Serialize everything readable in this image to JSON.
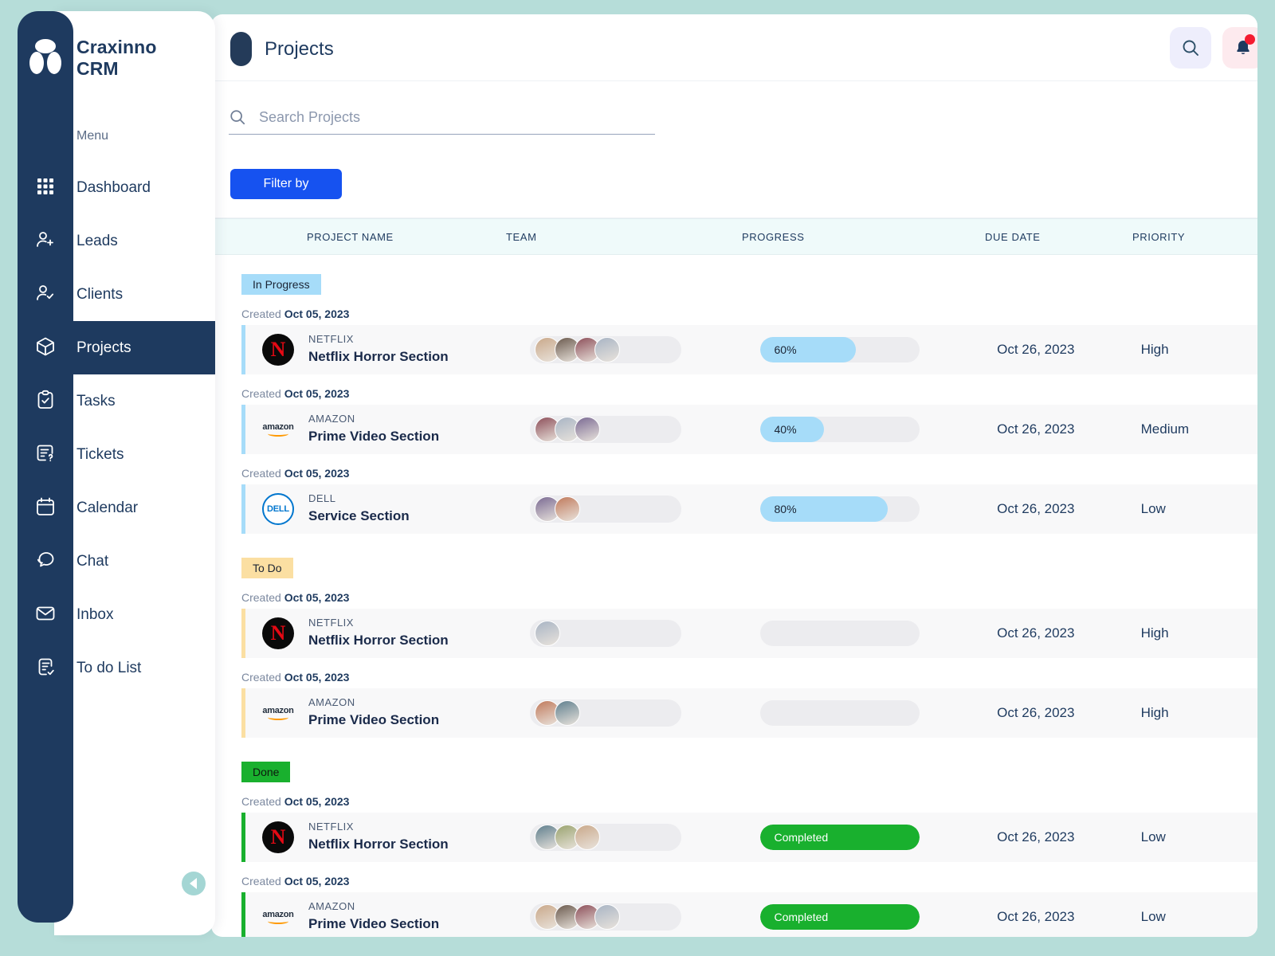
{
  "brand": {
    "name": "Craxinno CRM"
  },
  "sidebar": {
    "menu_label": "Menu",
    "items": [
      {
        "label": "Dashboard",
        "icon": "grid-icon",
        "active": false
      },
      {
        "label": "Leads",
        "icon": "user-plus-icon",
        "active": false
      },
      {
        "label": "Clients",
        "icon": "user-check-icon",
        "active": false
      },
      {
        "label": "Projects",
        "icon": "box-icon",
        "active": true
      },
      {
        "label": "Tasks",
        "icon": "clipboard-check-icon",
        "active": false
      },
      {
        "label": "Tickets",
        "icon": "ticket-question-icon",
        "active": false
      },
      {
        "label": "Calendar",
        "icon": "calendar-icon",
        "active": false
      },
      {
        "label": "Chat",
        "icon": "chat-bubbles-icon",
        "active": false
      },
      {
        "label": "Inbox",
        "icon": "envelope-icon",
        "active": false
      },
      {
        "label": "To do List",
        "icon": "list-check-icon",
        "active": false
      }
    ],
    "collapse_icon": "chevron-left-icon"
  },
  "header": {
    "title": "Projects",
    "search_icon": "search-icon",
    "bell_icon": "bell-icon",
    "has_notification": true
  },
  "toolbar": {
    "search_icon": "search-icon",
    "search_value": "",
    "search_placeholder": "Search Projects",
    "filter_label": "Filter by",
    "filter_color": "#1652F0"
  },
  "table": {
    "columns": [
      "PROJECT NAME",
      "TEAM",
      "PROGRESS",
      "DUE DATE",
      "PRIORITY"
    ],
    "groups": [
      {
        "status": "In Progress",
        "badge_bg": "#A6DCF9",
        "accent": "#A6DCF9",
        "rows": [
          {
            "created_label": "Created",
            "created_date": "Oct 05, 2023",
            "logo": "netflix",
            "company": "NETFLIX",
            "project": "Netflix Horror Section",
            "team_count": 4,
            "progress_type": "percent",
            "progress": "60%",
            "progress_value": 60,
            "due": "Oct 26, 2023",
            "priority": "High"
          },
          {
            "created_label": "Created",
            "created_date": "Oct 05, 2023",
            "logo": "amazon",
            "company": "AMAZON",
            "project": "Prime Video Section",
            "team_count": 3,
            "progress_type": "percent",
            "progress": "40%",
            "progress_value": 40,
            "due": "Oct 26, 2023",
            "priority": "Medium"
          },
          {
            "created_label": "Created",
            "created_date": "Oct 05, 2023",
            "logo": "dell",
            "company": "DELL",
            "project": "Service Section",
            "team_count": 2,
            "progress_type": "percent",
            "progress": "80%",
            "progress_value": 80,
            "due": "Oct 26, 2023",
            "priority": "Low"
          }
        ]
      },
      {
        "status": "To Do",
        "badge_bg": "#FBDFA2",
        "accent": "#FBDFA2",
        "rows": [
          {
            "created_label": "Created",
            "created_date": "Oct 05, 2023",
            "logo": "netflix",
            "company": "NETFLIX",
            "project": "Netflix Horror Section",
            "team_count": 1,
            "progress_type": "empty",
            "progress": "",
            "progress_value": 0,
            "due": "Oct 26, 2023",
            "priority": "High"
          },
          {
            "created_label": "Created",
            "created_date": "Oct 05, 2023",
            "logo": "amazon",
            "company": "AMAZON",
            "project": "Prime Video Section",
            "team_count": 2,
            "progress_type": "empty",
            "progress": "",
            "progress_value": 0,
            "due": "Oct 26, 2023",
            "priority": "High"
          }
        ]
      },
      {
        "status": "Done",
        "badge_bg": "#19B02E",
        "accent": "#19B02E",
        "rows": [
          {
            "created_label": "Created",
            "created_date": "Oct 05, 2023",
            "logo": "netflix",
            "company": "NETFLIX",
            "project": "Netflix Horror Section",
            "team_count": 3,
            "progress_type": "completed",
            "progress": "Completed",
            "progress_value": 100,
            "due": "Oct 26, 2023",
            "priority": "Low"
          },
          {
            "created_label": "Created",
            "created_date": "Oct 05, 2023",
            "logo": "amazon",
            "company": "AMAZON",
            "project": "Prime Video Section",
            "team_count": 4,
            "progress_type": "completed",
            "progress": "Completed",
            "progress_value": 100,
            "due": "Oct 26, 2023",
            "priority": "Low"
          }
        ]
      }
    ]
  }
}
